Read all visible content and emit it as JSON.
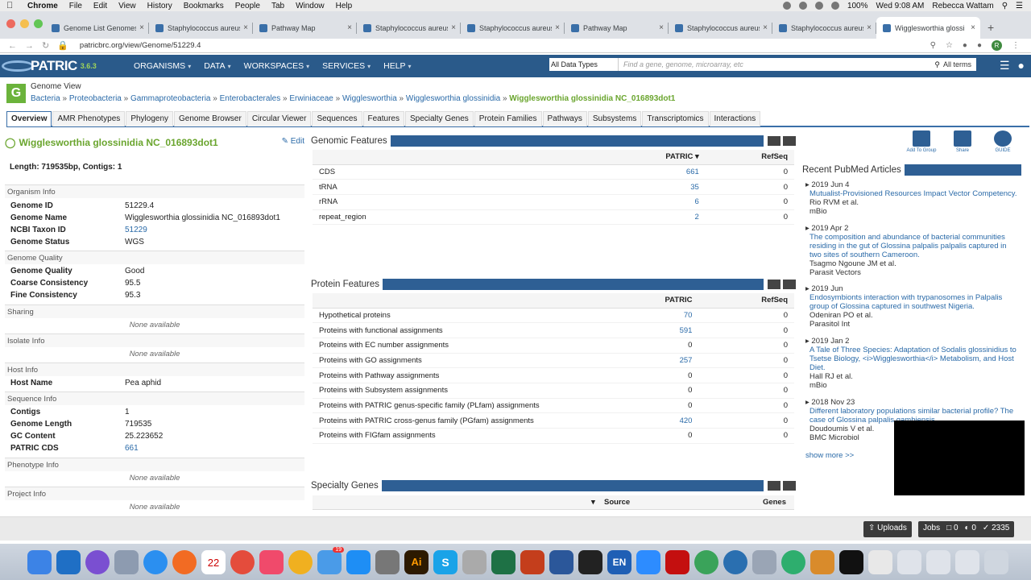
{
  "mac_menubar": {
    "app": "Chrome",
    "menus": [
      "File",
      "Edit",
      "View",
      "History",
      "Bookmarks",
      "People",
      "Tab",
      "Window",
      "Help"
    ],
    "battery": "100%",
    "clock": "Wed 9:08 AM",
    "user": "Rebecca Wattam"
  },
  "browser": {
    "tabs": [
      {
        "title": "Genome List Genomes"
      },
      {
        "title": "Staphylococcus aureus"
      },
      {
        "title": "Pathway Map"
      },
      {
        "title": "Staphylococcus aureus"
      },
      {
        "title": "Staphylococcus aureus"
      },
      {
        "title": "Pathway Map"
      },
      {
        "title": "Staphylococcus aureus"
      },
      {
        "title": "Staphylococcus aureus"
      },
      {
        "title": "Wigglesworthia glossi"
      }
    ],
    "url": "patricbrc.org/view/Genome/51229.4",
    "profile_initial": "R"
  },
  "topnav": {
    "brand": "PATRIC",
    "version": "3.6.3",
    "menus": [
      "ORGANISMS",
      "DATA",
      "WORKSPACES",
      "SERVICES",
      "HELP"
    ],
    "search_type": "All Data Types",
    "search_placeholder": "Find a gene, genome, microarray, etc",
    "search_terms": "All terms"
  },
  "header": {
    "icon_letter": "G",
    "view_title": "Genome View",
    "breadcrumb": [
      "Bacteria",
      "Proteobacteria",
      "Gammaproteobacteria",
      "Enterobacterales",
      "Erwiniaceae",
      "Wigglesworthia",
      "Wigglesworthia glossinidia"
    ],
    "current": "Wigglesworthia glossinidia NC_016893dot1"
  },
  "tabs": [
    "Overview",
    "AMR Phenotypes",
    "Phylogeny",
    "Genome Browser",
    "Circular Viewer",
    "Sequences",
    "Features",
    "Specialty Genes",
    "Protein Families",
    "Pathways",
    "Subsystems",
    "Transcriptomics",
    "Interactions"
  ],
  "left": {
    "title": "Wigglesworthia glossinidia NC_016893dot1",
    "edit": "Edit",
    "length": "Length: 719535bp, Contigs: 1",
    "organism_info": "Organism Info",
    "genome_id_k": "Genome ID",
    "genome_id_v": "51229.4",
    "genome_name_k": "Genome Name",
    "genome_name_v": "Wigglesworthia glossinidia NC_016893dot1",
    "taxon_k": "NCBI Taxon ID",
    "taxon_v": "51229",
    "status_k": "Genome Status",
    "status_v": "WGS",
    "genome_quality": "Genome Quality",
    "gq_k": "Genome Quality",
    "gq_v": "Good",
    "cc_k": "Coarse Consistency",
    "cc_v": "95.5",
    "fc_k": "Fine Consistency",
    "fc_v": "95.3",
    "sharing": "Sharing",
    "none": "None available",
    "isolate": "Isolate Info",
    "host": "Host Info",
    "host_k": "Host Name",
    "host_v": "Pea aphid",
    "seq": "Sequence Info",
    "contigs_k": "Contigs",
    "contigs_v": "1",
    "glen_k": "Genome Length",
    "glen_v": "719535",
    "gc_k": "GC Content",
    "gc_v": "25.223652",
    "cds_k": "PATRIC CDS",
    "cds_v": "661",
    "pheno": "Phenotype Info",
    "project": "Project Info"
  },
  "genomic": {
    "title": "Genomic Features",
    "col_patric": "PATRIC",
    "col_refseq": "RefSeq",
    "rows": [
      {
        "label": "CDS",
        "patric": "661",
        "refseq": "0"
      },
      {
        "label": "tRNA",
        "patric": "35",
        "refseq": "0"
      },
      {
        "label": "rRNA",
        "patric": "6",
        "refseq": "0"
      },
      {
        "label": "repeat_region",
        "patric": "2",
        "refseq": "0"
      }
    ]
  },
  "protein": {
    "title": "Protein Features",
    "col_patric": "PATRIC",
    "col_refseq": "RefSeq",
    "rows": [
      {
        "label": "Hypothetical proteins",
        "patric": "70",
        "refseq": "0"
      },
      {
        "label": "Proteins with functional assignments",
        "patric": "591",
        "refseq": "0"
      },
      {
        "label": "Proteins with EC number assignments",
        "patric": "0",
        "refseq": "0"
      },
      {
        "label": "Proteins with GO assignments",
        "patric": "257",
        "refseq": "0"
      },
      {
        "label": "Proteins with Pathway assignments",
        "patric": "0",
        "refseq": "0"
      },
      {
        "label": "Proteins with Subsystem assignments",
        "patric": "0",
        "refseq": "0"
      },
      {
        "label": "Proteins with PATRIC genus-specific family (PLfam) assignments",
        "patric": "0",
        "refseq": "0"
      },
      {
        "label": "Proteins with PATRIC cross-genus family (PGfam) assignments",
        "patric": "420",
        "refseq": "0"
      },
      {
        "label": "Proteins with FIGfam assignments",
        "patric": "0",
        "refseq": "0"
      }
    ]
  },
  "specialty": {
    "title": "Specialty Genes",
    "col_source": "Source",
    "col_genes": "Genes"
  },
  "right": {
    "tools": [
      "Add To Group",
      "Share",
      "GUIDE"
    ],
    "pubmed_title": "Recent PubMed Articles",
    "articles": [
      {
        "date": "2019 Jun 4",
        "title": "Mutualist-Provisioned Resources Impact Vector Competency.",
        "authors": "Rio RVM et al.",
        "journal": "mBio"
      },
      {
        "date": "2019 Apr 2",
        "title": "The composition and abundance of bacterial communities residing in the gut of Glossina palpalis palpalis captured in two sites of southern Cameroon.",
        "authors": "Tsagmo Ngoune JM et al.",
        "journal": "Parasit Vectors"
      },
      {
        "date": "2019 Jun",
        "title": "Endosymbionts interaction with trypanosomes in Palpalis group of Glossina captured in southwest Nigeria.",
        "authors": "Odeniran PO et al.",
        "journal": "Parasitol Int"
      },
      {
        "date": "2019 Jan 2",
        "title": "A Tale of Three Species: Adaptation of Sodalis glossinidius to Tsetse Biology, <i>Wigglesworthia</i> Metabolism, and Host Diet.",
        "authors": "Hall RJ et al.",
        "journal": "mBio"
      },
      {
        "date": "2018 Nov 23",
        "title": "Different laboratory populations similar bacterial profile? The case of Glossina palpalis gambiensis",
        "authors": "Doudoumis V et al.",
        "journal": "BMC Microbiol"
      }
    ],
    "show_more": "show more >>"
  },
  "status": {
    "uploads": "Uploads",
    "jobs": "Jobs",
    "q": "0",
    "r": "0",
    "done": "2335"
  },
  "dock": {
    "calendar_day": "22",
    "badge": "19"
  }
}
